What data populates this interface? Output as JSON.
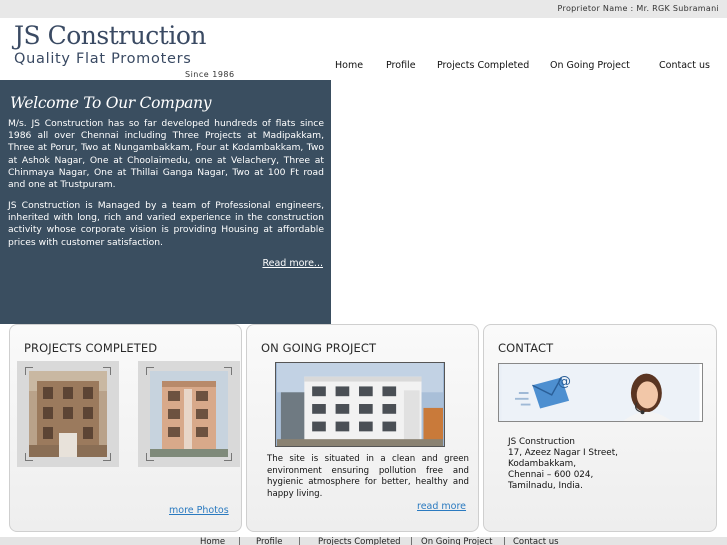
{
  "topbar": {
    "proprietor": "Proprietor Name : Mr. RGK Subramani"
  },
  "logo": {
    "name": "JS Construction",
    "tagline": "Quality Flat Promoters",
    "since": "Since 1986"
  },
  "nav": {
    "items": [
      "Home",
      "Profile",
      "Projects Completed",
      "On Going Project",
      "Contact us"
    ]
  },
  "welcome": {
    "title": "Welcome To Our Company",
    "paragraph1": "M/s. JS Construction has so far developed hundreds of flats since 1986 all over Chennai including Three Projects at Madipakkam, Three at Porur, Two at Nungambakkam, Four at Kodambakkam, Two at Ashok Nagar, One at Choolaimedu, one at Velachery, Three at Chinmaya Nagar, One at Thillai Ganga Nagar, Two at 100 Ft road and one at Trustpuram.",
    "paragraph2": "JS Construction is Managed by a team of Professional engineers, inherited with long, rich and varied experience in the construction activity whose corporate vision is providing Housing at affordable prices with customer satisfaction.",
    "read_more": "Read more..."
  },
  "projects_completed": {
    "title": "PROJECTS COMPLETED",
    "more_photos": "more Photos"
  },
  "ongoing": {
    "title": "ON GOING PROJECT",
    "text": "The site is situated in a clean and green environment ensuring pollution free and hygienic atmosphere for better, healthy and happy living.",
    "read_more": "read more"
  },
  "contact": {
    "title": "CONTACT",
    "address": [
      "JS Construction",
      "17, Azeez Nagar I Street,",
      "Kodambakkam,",
      "Chennai – 600 024,",
      "Tamilnadu, India."
    ]
  },
  "footer": {
    "items": [
      "Home",
      "Profile",
      "Projects Completed",
      "On Going Project",
      "Contact us"
    ],
    "separator": "|"
  },
  "colors": {
    "welcome_bg": "#3a4e60",
    "logo_text": "#3a4a63",
    "link": "#2a7ac0"
  }
}
